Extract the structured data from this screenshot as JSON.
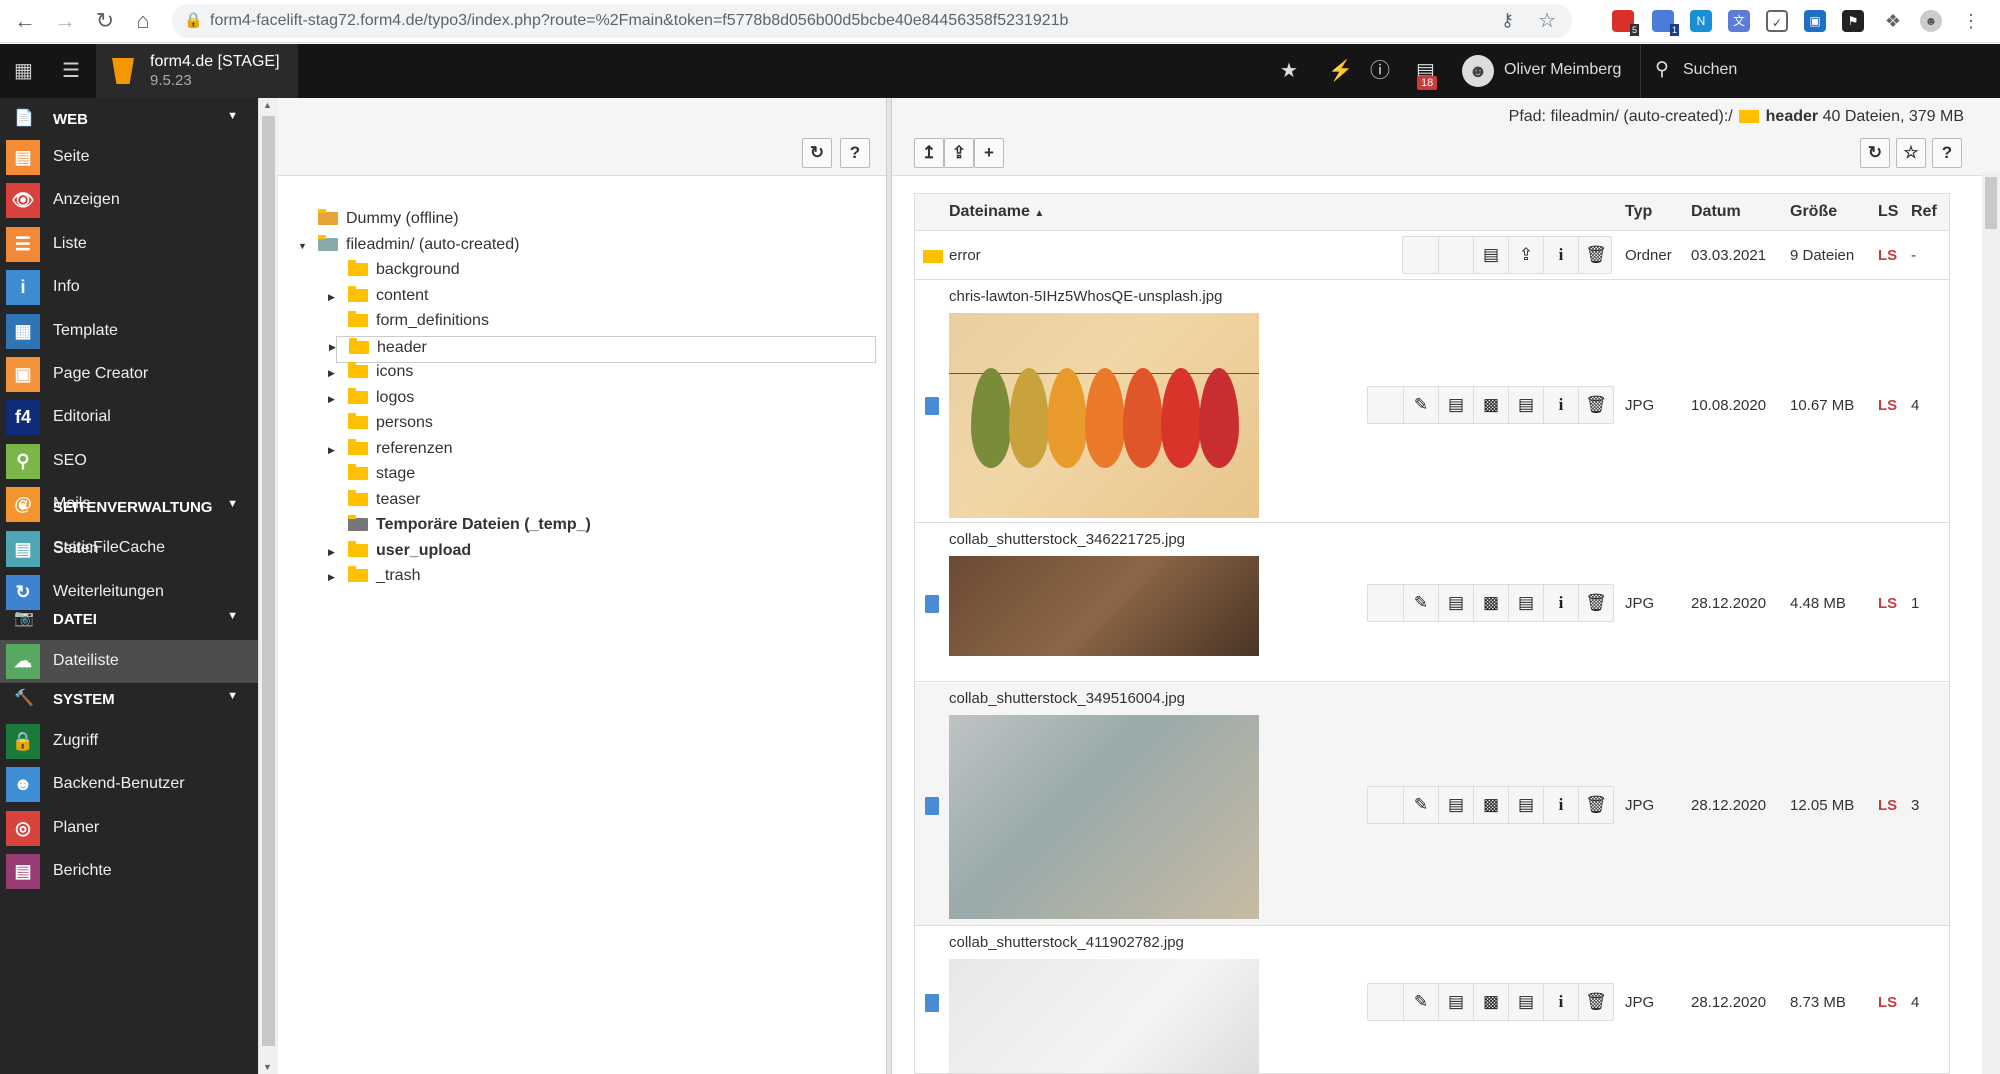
{
  "browser": {
    "url": "form4-facelift-stag72.form4.de/typo3/index.php?route=%2Fmain&token=f5778b8d056b00d5bcbe40e84456358f5231921b",
    "ext_badges": [
      "5",
      "1"
    ]
  },
  "topbar": {
    "site_name": "form4.de [STAGE]",
    "version": "9.5.23",
    "notification_count": "18",
    "user_name": "Oliver Meimberg",
    "search_label": "Suchen"
  },
  "sidebar": {
    "groups": [
      {
        "label": "WEB",
        "items": [
          {
            "label": "Seite",
            "color": "#f48c35"
          },
          {
            "label": "Anzeigen",
            "color": "#d9423c"
          },
          {
            "label": "Liste",
            "color": "#f08a38"
          },
          {
            "label": "Info",
            "color": "#3d8cd2"
          },
          {
            "label": "Template",
            "color": "#2f74b5"
          },
          {
            "label": "Page Creator",
            "color": "#f3923a"
          },
          {
            "label": "Editorial",
            "color": "#0f2b79"
          },
          {
            "label": "SEO",
            "color": "#7ab648"
          },
          {
            "label": "Mails",
            "color": "#f3942f"
          },
          {
            "label": "StaticFileCache",
            "color": "#52a65c"
          }
        ]
      },
      {
        "label": "SEITENVERWALTUNG",
        "items": [
          {
            "label": "Seiten",
            "color": "#4ea6b5"
          },
          {
            "label": "Weiterleitungen",
            "color": "#3e83d0"
          }
        ]
      },
      {
        "label": "DATEI",
        "items": [
          {
            "label": "Dateiliste",
            "color": "#58a862"
          }
        ]
      },
      {
        "label": "SYSTEM",
        "items": [
          {
            "label": "Zugriff",
            "color": "#197a3b"
          },
          {
            "label": "Backend-Benutzer",
            "color": "#3f8dd5"
          },
          {
            "label": "Planer",
            "color": "#d9433d"
          },
          {
            "label": "Berichte",
            "color": "#973d74"
          }
        ]
      }
    ]
  },
  "tree": {
    "items": [
      {
        "label": "Dummy (offline)",
        "level": 0
      },
      {
        "label": "fileadmin/ (auto-created)",
        "level": 0
      },
      {
        "label": "background",
        "level": 1
      },
      {
        "label": "content",
        "level": 1
      },
      {
        "label": "form_definitions",
        "level": 1
      },
      {
        "label": "header",
        "level": 1
      },
      {
        "label": "icons",
        "level": 1
      },
      {
        "label": "logos",
        "level": 1
      },
      {
        "label": "persons",
        "level": 1
      },
      {
        "label": "referenzen",
        "level": 1
      },
      {
        "label": "stage",
        "level": 1
      },
      {
        "label": "teaser",
        "level": 1
      },
      {
        "label": "Temporäre Dateien (_temp_)",
        "level": 1
      },
      {
        "label": "user_upload",
        "level": 1
      },
      {
        "label": "_trash",
        "level": 1
      }
    ]
  },
  "main": {
    "path_prefix": "Pfad: fileadmin/ (auto-created):/",
    "path_folder": "header",
    "path_stats": "40 Dateien, 379 MB",
    "columns": {
      "name": "Dateiname",
      "type": "Typ",
      "date": "Datum",
      "size": "Größe",
      "ls": "LS",
      "ref": "Ref"
    },
    "rows": [
      {
        "name": "error",
        "type": "Ordner",
        "date": "03.03.2021",
        "size": "9 Dateien",
        "ls": "LS",
        "ref": "-"
      },
      {
        "name": "chris-lawton-5IHz5WhosQE-unsplash.jpg",
        "type": "JPG",
        "date": "10.08.2020",
        "size": "10.67 MB",
        "ls": "LS",
        "ref": "4"
      },
      {
        "name": "collab_shutterstock_346221725.jpg",
        "type": "JPG",
        "date": "28.12.2020",
        "size": "4.48 MB",
        "ls": "LS",
        "ref": "1"
      },
      {
        "name": "collab_shutterstock_349516004.jpg",
        "type": "JPG",
        "date": "28.12.2020",
        "size": "12.05 MB",
        "ls": "LS",
        "ref": "3"
      },
      {
        "name": "collab_shutterstock_411902782.jpg",
        "type": "JPG",
        "date": "28.12.2020",
        "size": "8.73 MB",
        "ls": "LS",
        "ref": "4"
      }
    ]
  }
}
